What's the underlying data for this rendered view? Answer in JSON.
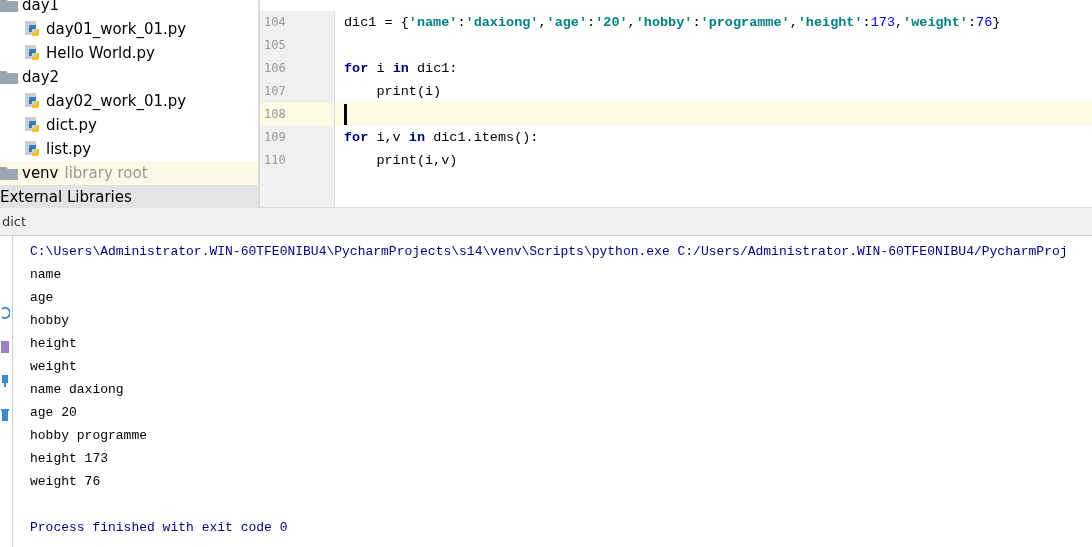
{
  "project_tree": [
    {
      "label": "day1",
      "kind": "folder",
      "selected": false,
      "children": [
        {
          "label": "day01_work_01.py",
          "kind": "python",
          "selected": false
        },
        {
          "label": "Hello World.py",
          "kind": "python",
          "selected": false
        }
      ]
    },
    {
      "label": "day2",
      "kind": "folder",
      "selected": false,
      "children": [
        {
          "label": "day02_work_01.py",
          "kind": "python",
          "selected": false
        },
        {
          "label": "dict.py",
          "kind": "python",
          "selected": false
        },
        {
          "label": "list.py",
          "kind": "python",
          "selected": false
        }
      ]
    },
    {
      "label": "venv",
      "hint": "library root",
      "kind": "folder",
      "selected": true
    },
    {
      "label": "External Libraries",
      "kind": "library",
      "selected": false
    }
  ],
  "editor": {
    "lines": [
      {
        "number": "104",
        "current": false,
        "tokens": [
          {
            "text": "dic1 = {",
            "kind": "plain"
          },
          {
            "text": "'name'",
            "kind": "string"
          },
          {
            "text": ":",
            "kind": "plain"
          },
          {
            "text": "'daxiong'",
            "kind": "string"
          },
          {
            "text": ",",
            "kind": "plain"
          },
          {
            "text": "'age'",
            "kind": "string"
          },
          {
            "text": ":",
            "kind": "plain"
          },
          {
            "text": "'20'",
            "kind": "string"
          },
          {
            "text": ",",
            "kind": "plain"
          },
          {
            "text": "'hobby'",
            "kind": "string"
          },
          {
            "text": ":",
            "kind": "plain"
          },
          {
            "text": "'programme'",
            "kind": "string"
          },
          {
            "text": ",",
            "kind": "plain"
          },
          {
            "text": "'height'",
            "kind": "string"
          },
          {
            "text": ":",
            "kind": "plain"
          },
          {
            "text": "173",
            "kind": "number"
          },
          {
            "text": ",",
            "kind": "plain"
          },
          {
            "text": "'weight'",
            "kind": "string"
          },
          {
            "text": ":",
            "kind": "plain"
          },
          {
            "text": "76",
            "kind": "number"
          },
          {
            "text": "}",
            "kind": "plain"
          }
        ]
      },
      {
        "number": "105",
        "current": false
      },
      {
        "number": "106",
        "current": false,
        "tokens": [
          {
            "text": "for",
            "kind": "keyword"
          },
          {
            "text": " i ",
            "kind": "plain"
          },
          {
            "text": "in",
            "kind": "keyword"
          },
          {
            "text": " dic1:",
            "kind": "plain"
          }
        ]
      },
      {
        "number": "107",
        "current": false,
        "tokens": [
          {
            "text": "    print(i)",
            "kind": "plain"
          }
        ]
      },
      {
        "number": "108",
        "current": true
      },
      {
        "number": "109",
        "current": false,
        "tokens": [
          {
            "text": "for",
            "kind": "keyword"
          },
          {
            "text": " i,v ",
            "kind": "plain"
          },
          {
            "text": "in",
            "kind": "keyword"
          },
          {
            "text": " dic1.items():",
            "kind": "plain"
          }
        ]
      },
      {
        "number": "110",
        "current": false,
        "tokens": [
          {
            "text": "    print(i,v)",
            "kind": "plain"
          }
        ]
      }
    ]
  },
  "run_panel": {
    "tab": "dict",
    "lines": [
      {
        "text": "C:\\Users\\Administrator.WIN-60TFE0NIBU4\\PycharmProjects\\s14\\venv\\Scripts\\python.exe C:/Users/Administrator.WIN-60TFE0NIBU4/PycharmProj",
        "kind": "system"
      },
      {
        "text": "name",
        "kind": "output"
      },
      {
        "text": "age",
        "kind": "output"
      },
      {
        "text": "hobby",
        "kind": "output"
      },
      {
        "text": "height",
        "kind": "output"
      },
      {
        "text": "weight",
        "kind": "output"
      },
      {
        "text": "name daxiong",
        "kind": "output"
      },
      {
        "text": "age 20",
        "kind": "output"
      },
      {
        "text": "hobby programme",
        "kind": "output"
      },
      {
        "text": "height 173",
        "kind": "output"
      },
      {
        "text": "weight 76",
        "kind": "output"
      },
      {
        "kind": "blank"
      },
      {
        "text": "Process finished with exit code 0",
        "kind": "system"
      }
    ]
  }
}
